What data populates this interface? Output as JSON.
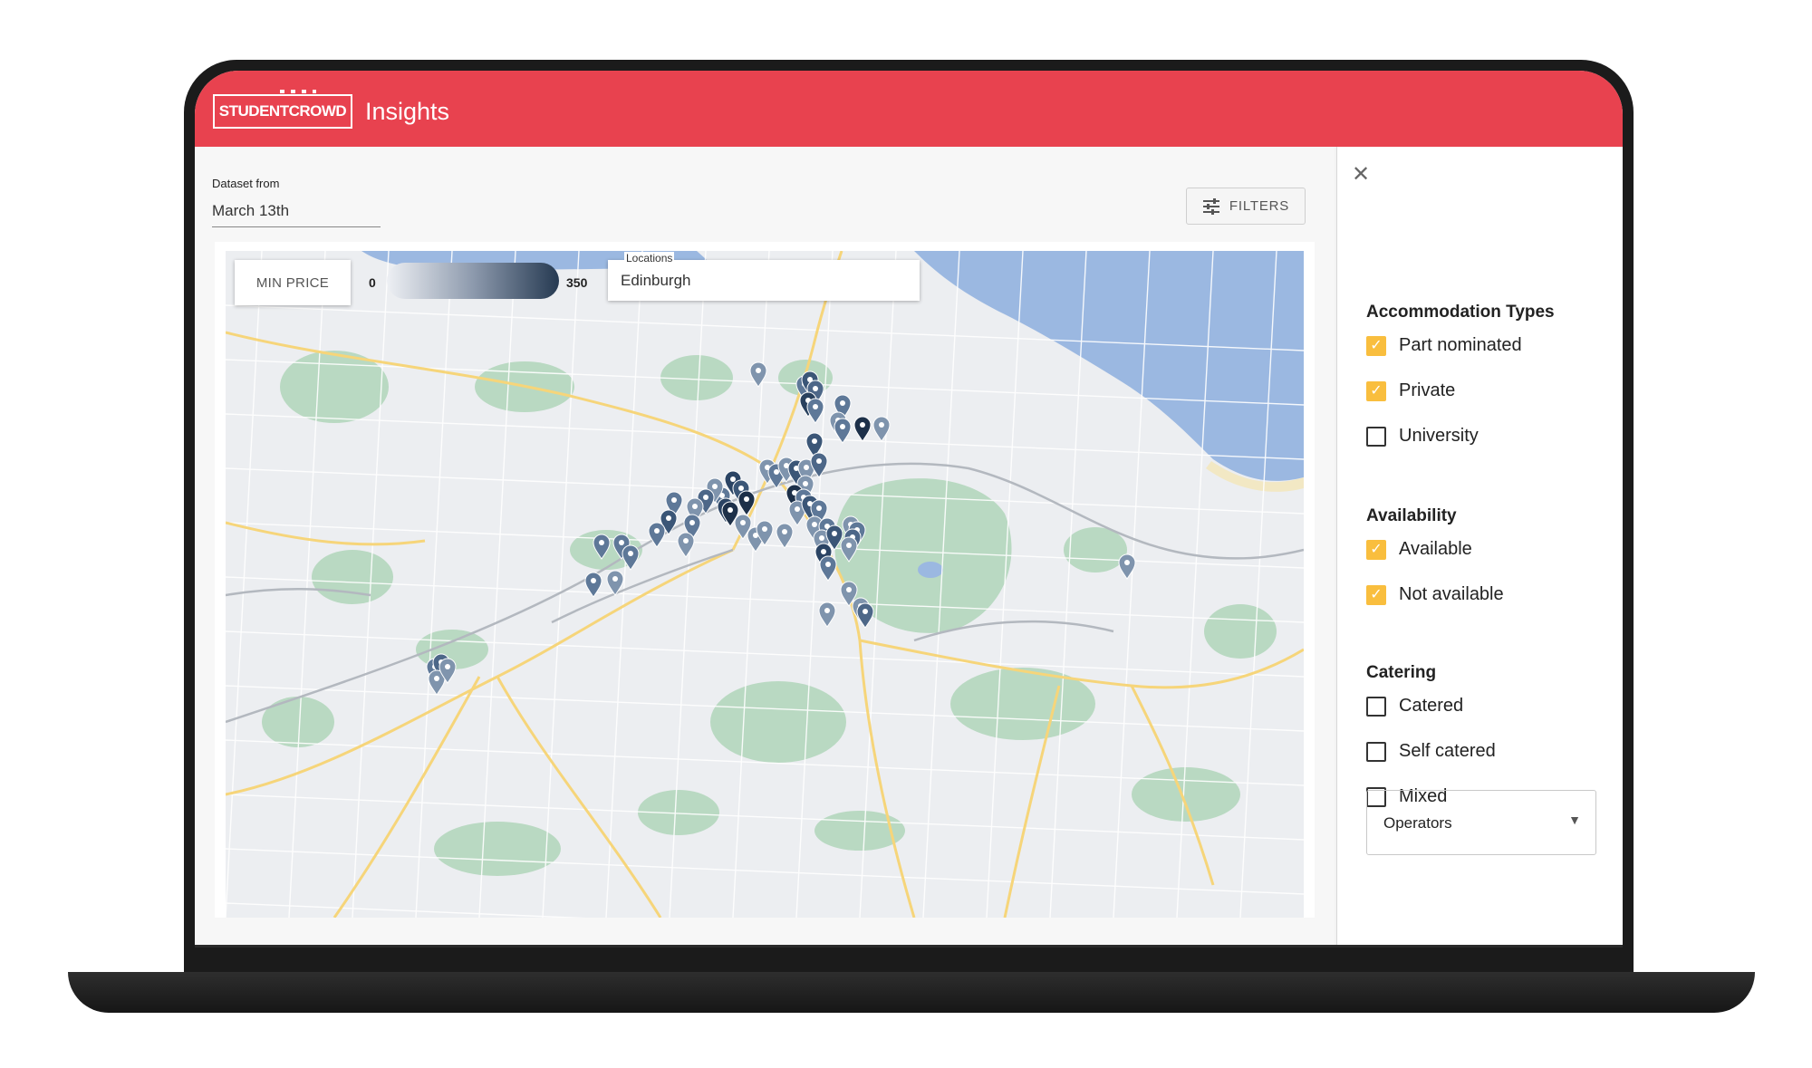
{
  "app": {
    "logo_text": "STUDENTCROWD",
    "brand_suffix": "Insights",
    "brand_color": "#e8424f"
  },
  "dataset": {
    "label": "Dataset from",
    "value": "March 13th"
  },
  "filters_button": {
    "label": "FILTERS",
    "icon": "tune-icon"
  },
  "map": {
    "min_price_label": "MIN PRICE",
    "range_min": "0",
    "range_max": "350",
    "locations_label": "Locations",
    "locations_value": "Edinburgh"
  },
  "side_panel": {
    "close_icon": "close-icon",
    "sections": [
      {
        "title": "Accommodation Types",
        "options": [
          {
            "label": "Part nominated",
            "checked": true
          },
          {
            "label": "Private",
            "checked": true
          },
          {
            "label": "University",
            "checked": false
          }
        ]
      },
      {
        "title": "Availability",
        "options": [
          {
            "label": "Available",
            "checked": true
          },
          {
            "label": "Not available",
            "checked": true
          }
        ]
      },
      {
        "title": "Catering",
        "options": [
          {
            "label": "Catered",
            "checked": false
          },
          {
            "label": "Self catered",
            "checked": false
          },
          {
            "label": "Mixed",
            "checked": false
          }
        ]
      }
    ],
    "operators_label": "Operators",
    "checkbox_color": "#f9be3e"
  }
}
